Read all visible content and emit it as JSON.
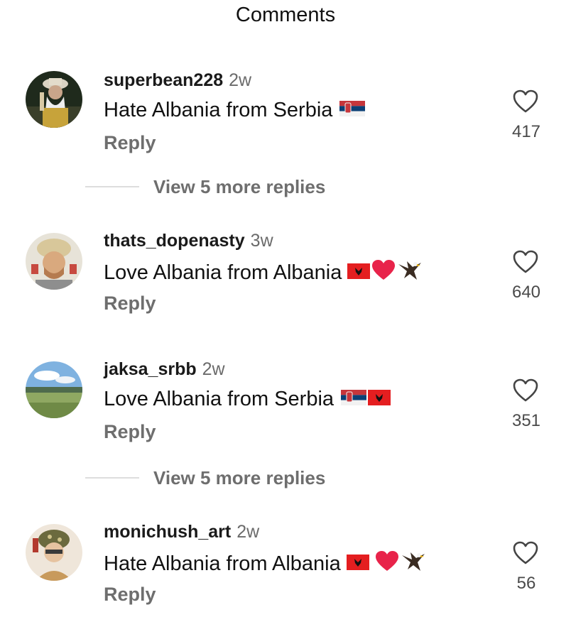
{
  "header": {
    "title": "Comments"
  },
  "comments": [
    {
      "username": "superbean228",
      "time": "2w",
      "text": "Hate Albania from Serbia",
      "emojis": [
        "serbia-flag"
      ],
      "reply": "Reply",
      "likes": "417",
      "view_replies": "View 5 more replies"
    },
    {
      "username": "thats_dopenasty",
      "time": "3w",
      "text": "Love Albania from Albania",
      "emojis": [
        "albania-flag",
        "red-heart",
        "eagle"
      ],
      "reply": "Reply",
      "likes": "640"
    },
    {
      "username": "jaksa_srbb",
      "time": "2w",
      "text": "Love Albania from Serbia",
      "emojis": [
        "serbia-flag",
        "albania-flag"
      ],
      "reply": "Reply",
      "likes": "351",
      "view_replies": "View 5 more replies"
    },
    {
      "username": "monichush_art",
      "time": "2w",
      "text": "Hate Albania from Albania",
      "emojis": [
        "albania-flag",
        "red-heart",
        "eagle"
      ],
      "reply": "Reply",
      "likes": "56"
    }
  ],
  "colors": {
    "text": "#111111",
    "secondary_text": "#6e6e6e",
    "serbia_red": "#c6363c",
    "serbia_blue": "#0c4076",
    "albania_red": "#e41e20",
    "heart_red": "#e8234a"
  }
}
